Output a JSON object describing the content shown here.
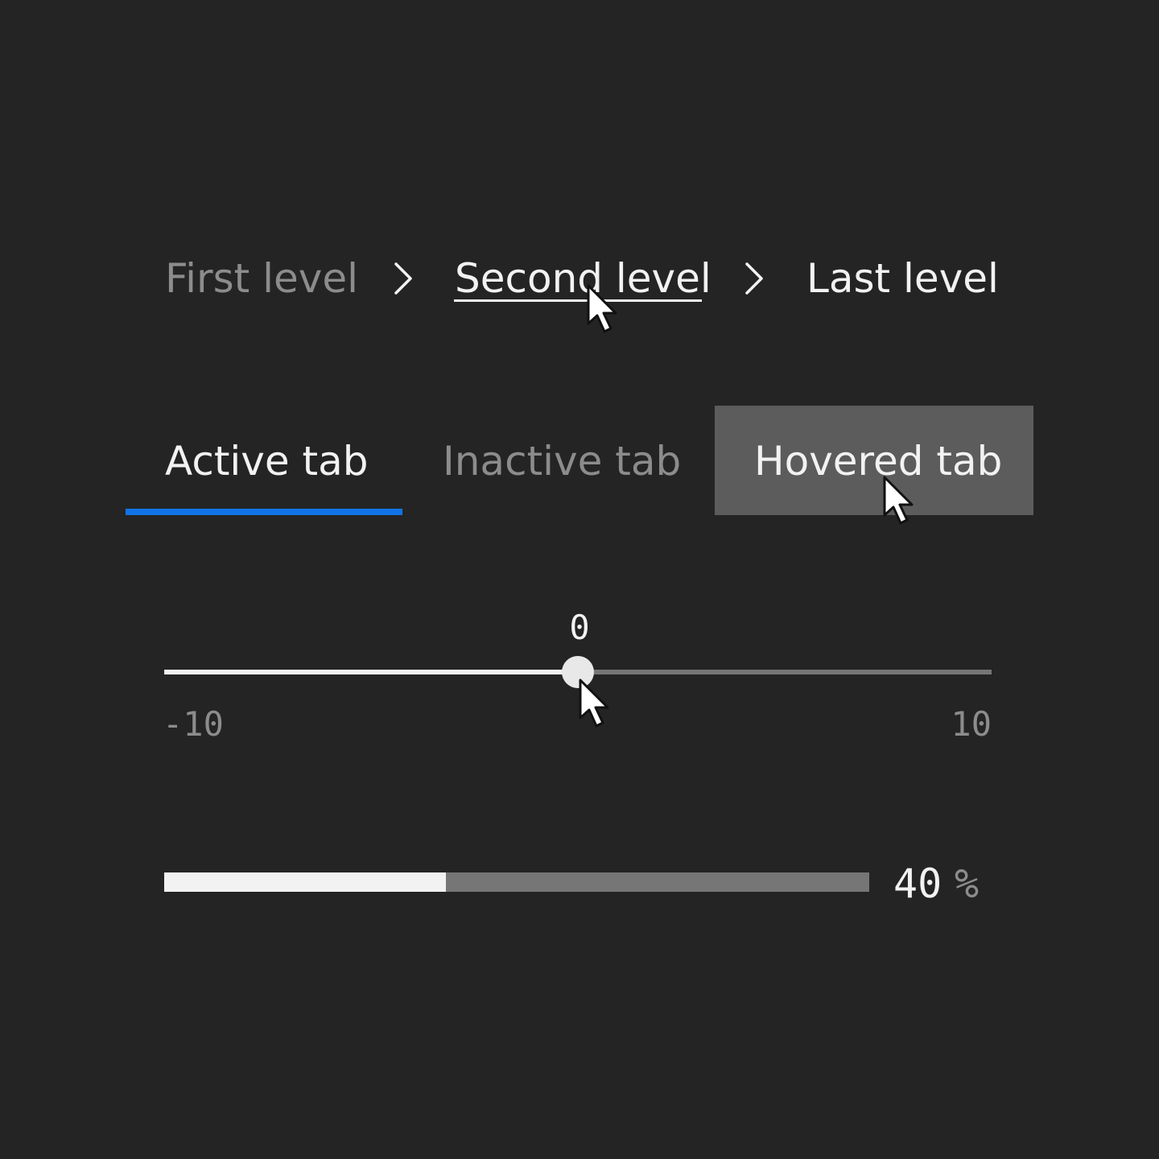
{
  "breadcrumb": {
    "items": [
      {
        "label": "First level"
      },
      {
        "label": "Second level"
      },
      {
        "label": "Last level"
      }
    ],
    "separator_icon": "chevron-right-icon"
  },
  "tabs": {
    "items": [
      {
        "label": "Active tab",
        "state": "active"
      },
      {
        "label": "Inactive tab",
        "state": "inactive"
      },
      {
        "label": "Hovered tab",
        "state": "hovered"
      }
    ],
    "active_indicator_color": "#1174e6"
  },
  "slider": {
    "value": 0,
    "value_label": "0",
    "min": -10,
    "min_label": "-10",
    "max": 10,
    "max_label": "10"
  },
  "progress": {
    "value": 40,
    "value_label": "40",
    "unit": "%"
  },
  "colors": {
    "background": "#242424",
    "text_primary": "#f2f2f2",
    "text_secondary": "#8c8c8c",
    "accent": "#1174e6",
    "hover_bg": "#5c5c5c",
    "track": "#767676"
  },
  "cursor_icon": "mouse-pointer-icon"
}
